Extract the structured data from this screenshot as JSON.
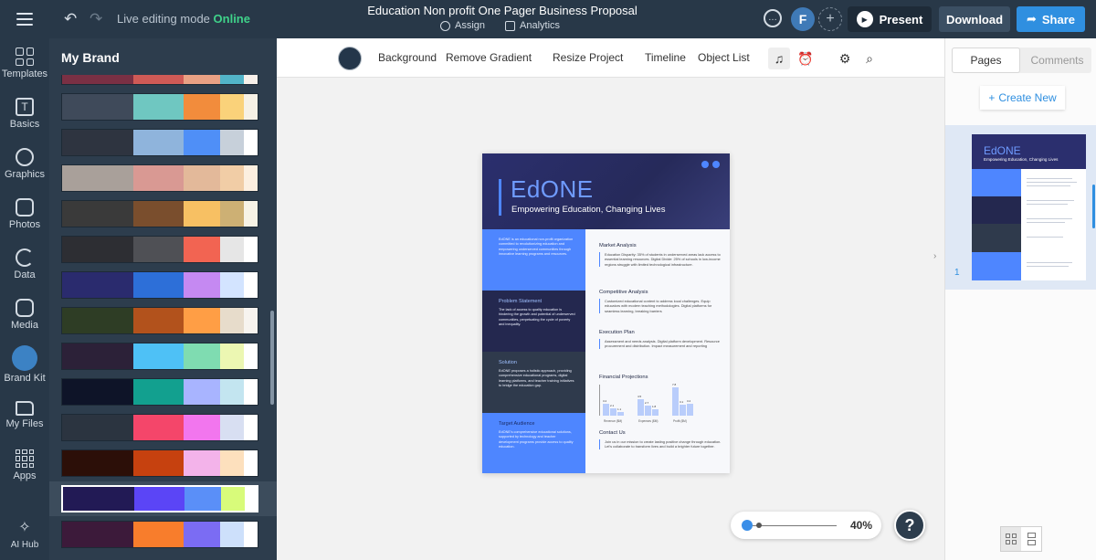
{
  "topbar": {
    "mode_label": "Live editing mode",
    "mode_status": "Online",
    "doc_title": "Education Non profit One Pager Business Proposal",
    "assign_label": "Assign",
    "analytics_label": "Analytics",
    "avatar_initial": "F",
    "present_label": "Present",
    "download_label": "Download",
    "share_label": "Share"
  },
  "rail": {
    "items": [
      {
        "label": "Templates",
        "icon": "templates-icon"
      },
      {
        "label": "Basics",
        "icon": "text-icon"
      },
      {
        "label": "Graphics",
        "icon": "graphics-icon"
      },
      {
        "label": "Photos",
        "icon": "photos-icon"
      },
      {
        "label": "Data",
        "icon": "pie-chart-icon"
      },
      {
        "label": "Media",
        "icon": "media-icon"
      },
      {
        "label": "Brand Kit",
        "icon": "brand-kit-icon"
      },
      {
        "label": "My Files",
        "icon": "folder-icon"
      },
      {
        "label": "Apps",
        "icon": "apps-icon"
      },
      {
        "label": "AI Hub",
        "icon": "sparkle-icon"
      }
    ]
  },
  "panel": {
    "title": "My Brand",
    "palettes": [
      [
        "#7a3044",
        "#cf5a56",
        "#e9a184",
        "#52b4c8",
        "#f7f0ea"
      ],
      [
        "#3f4a5a",
        "#6fc7c1",
        "#f28c3c",
        "#fad27a",
        "#f6f1e6"
      ],
      [
        "#2e3440",
        "#8fb4dc",
        "#4f8ff7",
        "#c7d0da",
        "#ffffff"
      ],
      [
        "#a9a09a",
        "#d99993",
        "#e3b99a",
        "#f1cda6",
        "#fcefe0"
      ],
      [
        "#3a3a3a",
        "#7a4e2d",
        "#f7c063",
        "#cdb074",
        "#f7f3e6"
      ],
      [
        "#2d2e33",
        "#4f5055",
        "#f26452",
        "#e6e6e6",
        "#ffffff"
      ],
      [
        "#2a2b6e",
        "#2d6fd8",
        "#c589f2",
        "#d3e4ff",
        "#ffffff"
      ],
      [
        "#2e3d25",
        "#b2521c",
        "#ff9e45",
        "#e7dccb",
        "#f7f4ef"
      ],
      [
        "#2c2138",
        "#4ec1f6",
        "#7fdcb1",
        "#ecf7b2",
        "#ffffff"
      ],
      [
        "#0e1428",
        "#12a08f",
        "#a8b4ff",
        "#c3e5f0",
        "#ffffff"
      ],
      [
        "#2b3440",
        "#f4466a",
        "#f276ee",
        "#d8dff2",
        "#ffffff"
      ],
      [
        "#2c0f08",
        "#c6410f",
        "#f3b3ea",
        "#fde0bd",
        "#ffffff"
      ],
      [
        "#221a55",
        "#5b45f6",
        "#5a8ff8",
        "#d8fb7a",
        "#ffffff"
      ],
      [
        "#3c1a3a",
        "#f87d2c",
        "#7b6cf3",
        "#cde0fb",
        "#ffffff"
      ]
    ]
  },
  "toolbar": {
    "background_label": "Background",
    "remove_gradient_label": "Remove Gradient",
    "resize_label": "Resize Project",
    "timeline_label": "Timeline",
    "object_list_label": "Object List"
  },
  "document": {
    "brand": "EdONE",
    "tagline": "Empowering Education, Changing Lives",
    "left_blocks": [
      {
        "heading": "",
        "body": "EdONE is an educational non-profit organization committed to revolutionizing education and empowering underserved communities through innovative learning programs and resources."
      },
      {
        "heading": "Problem Statement",
        "body": "The lack of access to quality education is hindering the growth and potential of underserved communities, perpetuating the cycle of poverty and inequality."
      },
      {
        "heading": "Solution",
        "body": "EdONE proposes a holistic approach, providing comprehensive educational programs, digital learning platforms, and teacher training initiatives to bridge the education gap."
      },
      {
        "heading": "Target Audience",
        "body": "EdONE's comprehensive educational solutions, supported by technology and teacher development programs provide access to quality education."
      }
    ],
    "right_sections": [
      {
        "heading": "Market Analysis",
        "body": "Education Disparity: 35% of students in underserved areas lack access to essential learning resources. Digital Divide: 25% of schools in low-income regions struggle with limited technological infrastructure."
      },
      {
        "heading": "Competitive Analysis",
        "body": "Customized educational content to address local challenges. Equip educators with modern teaching methodologies. Digital platforms for seamless learning, breaking barriers"
      },
      {
        "heading": "Execution Plan",
        "body": "Assessment and needs analysis. Digital platform development. Resource procurement and distribution. Impact measurement and reporting"
      },
      {
        "heading": "Financial Projections",
        "body": ""
      },
      {
        "heading": "Contact Us",
        "body": "Join us in our mission to create lasting positive change through education. Let's collaborate to transform lives and build a brighter future together."
      }
    ]
  },
  "chart_data": {
    "type": "bar",
    "title": "Financial Projections",
    "categories": [
      "Revenue ($M)",
      "Expenses ($M)",
      "Profit ($M)"
    ],
    "series": [
      {
        "values": [
          3.2,
          4.5,
          7.8
        ]
      },
      {
        "values": [
          2.1,
          2.7,
          3.1
        ]
      },
      {
        "values": [
          1.1,
          1.8,
          3.2
        ]
      }
    ],
    "ylim": [
      0,
      8
    ]
  },
  "zoom": {
    "level": "40%",
    "fraction": 0.0
  },
  "help_label": "?",
  "right_panel": {
    "tab_pages": "Pages",
    "tab_comments": "Comments",
    "create_new": "Create New",
    "page_number": "1"
  }
}
